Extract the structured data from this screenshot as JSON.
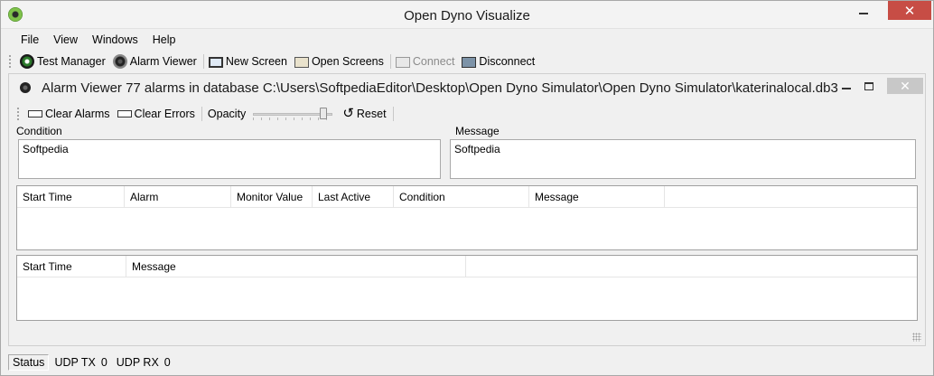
{
  "window": {
    "title": "Open Dyno Visualize"
  },
  "menu": [
    "File",
    "View",
    "Windows",
    "Help"
  ],
  "toolbar": {
    "test_manager": "Test Manager",
    "alarm_viewer": "Alarm Viewer",
    "new_screen": "New Screen",
    "open_screens": "Open Screens",
    "connect": "Connect",
    "disconnect": "Disconnect"
  },
  "child": {
    "title": "Alarm Viewer 77 alarms in database C:\\Users\\SoftpediaEditor\\Desktop\\Open Dyno Simulator\\Open Dyno Simulator\\katerinalocal.db3",
    "toolbar": {
      "clear_alarms": "Clear Alarms",
      "clear_errors": "Clear Errors",
      "opacity": "Opacity",
      "opacity_value_fraction": 0.9,
      "reset": "Reset"
    },
    "condition_label": "Condition",
    "condition_value": "Softpedia",
    "message_label": "Message",
    "message_value": "Softpedia",
    "alarms_columns": [
      "Start Time",
      "Alarm",
      "Monitor Value",
      "Last Active",
      "Condition",
      "Message"
    ],
    "errors_columns": [
      "Start Time",
      "Message"
    ]
  },
  "status": {
    "label": "Status",
    "udp_tx_label": "UDP TX",
    "udp_tx_value": "0",
    "udp_rx_label": "UDP RX",
    "udp_rx_value": "0"
  }
}
